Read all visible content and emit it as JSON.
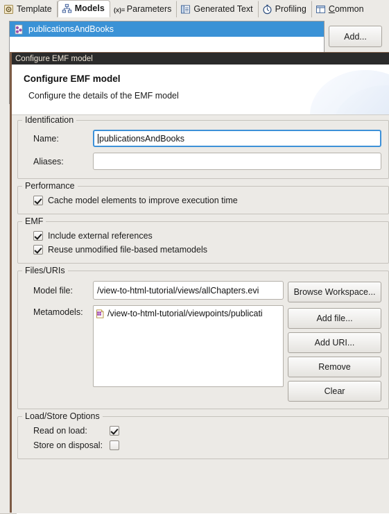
{
  "tabs": [
    {
      "label": "Template",
      "icon": "template-icon",
      "active": false,
      "mnemonic": ""
    },
    {
      "label": "Models",
      "icon": "models-icon",
      "active": true,
      "mnemonic": ""
    },
    {
      "label": "Parameters",
      "icon": "parameters-icon",
      "active": false,
      "mnemonic": ""
    },
    {
      "label": "Generated Text",
      "icon": "generated-text-icon",
      "active": false,
      "mnemonic": ""
    },
    {
      "label": "Profiling",
      "icon": "profiling-icon",
      "active": false,
      "mnemonic": ""
    },
    {
      "label": "Common",
      "icon": "common-icon",
      "active": false,
      "mnemonic": "C"
    }
  ],
  "models_page": {
    "list": {
      "selected_item": "publicationsAndBooks",
      "item_icon": "model-icon"
    },
    "add_label": "Add..."
  },
  "dialog": {
    "titlebar": "Configure EMF model",
    "banner_title": "Configure EMF model",
    "banner_subtitle": "Configure the details of the EMF model",
    "identification": {
      "group_title": "Identification",
      "name_label": "Name:",
      "name_value": "publicationsAndBooks",
      "name_placeholder": "",
      "aliases_label": "Aliases:",
      "aliases_value": "",
      "aliases_placeholder": ""
    },
    "performance": {
      "group_title": "Performance",
      "cache_label": "Cache model elements to improve execution time",
      "cache_checked": true
    },
    "emf": {
      "group_title": "EMF",
      "include_external_label": "Include external references",
      "include_external_checked": true,
      "reuse_metamodels_label": "Reuse unmodified file-based metamodels",
      "reuse_metamodels_checked": true
    },
    "files": {
      "group_title": "Files/URIs",
      "model_file_label": "Model file:",
      "model_file_value": "/view-to-html-tutorial/views/allChapters.evi",
      "metamodels_label": "Metamodels:",
      "metamodels_items": [
        {
          "icon": "ecore-file-icon",
          "text": "/view-to-html-tutorial/viewpoints/publicati"
        }
      ],
      "browse_workspace_label": "Browse Workspace...",
      "add_file_label": "Add file...",
      "add_uri_label": "Add URI...",
      "remove_label": "Remove",
      "clear_label": "Clear"
    },
    "load_store": {
      "group_title": "Load/Store Options",
      "read_on_load_label": "Read on load:",
      "read_on_load_checked": true,
      "store_on_disposal_label": "Store on disposal:",
      "store_on_disposal_checked": false
    }
  },
  "colors": {
    "selection_blue": "#3a92d6",
    "focus_blue": "#3d91d8",
    "dialog_border_brown": "#7d5b45",
    "titlebar_dark": "#2b2b2b",
    "panel_grey": "#eceae6"
  }
}
